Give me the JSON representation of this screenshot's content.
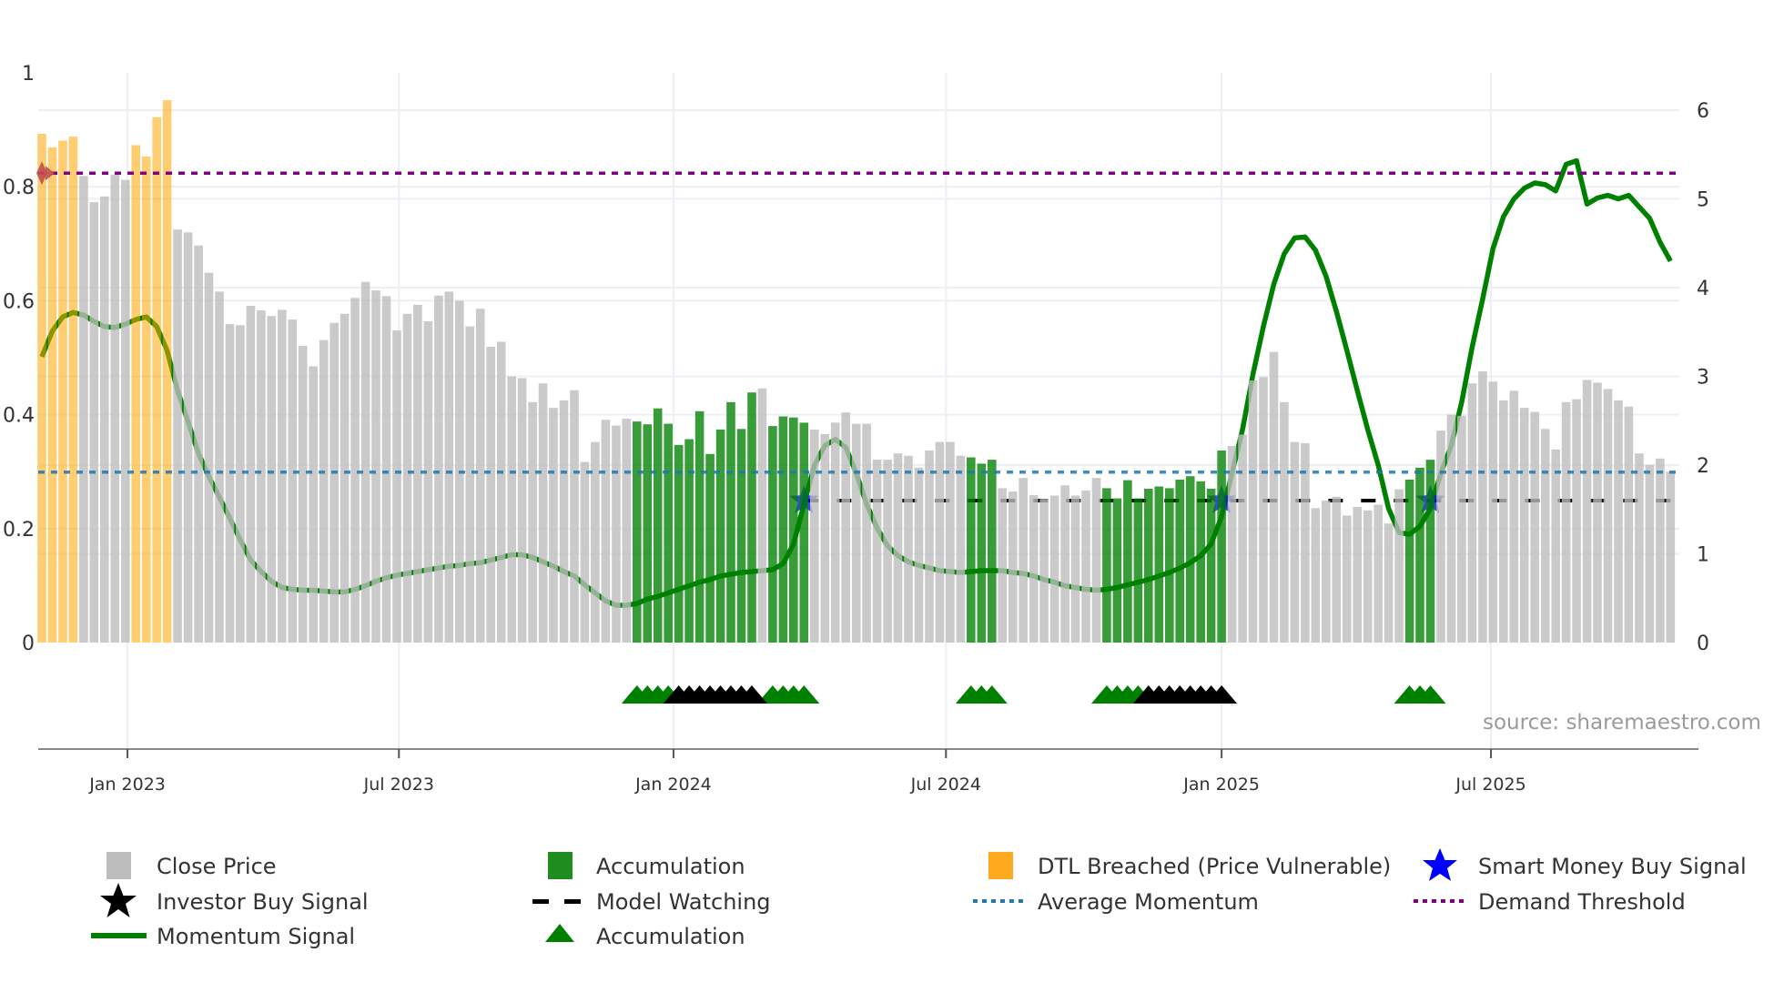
{
  "chart_data": {
    "type": "bar",
    "title": "",
    "xlabel": "",
    "ylabel_left": "",
    "ylabel_right": "",
    "ylim_left": [
      0,
      1
    ],
    "ylim_right": [
      0,
      6
    ],
    "yticks_left": [
      "0",
      "0.2",
      "0.4",
      "0.6",
      "0.8",
      "1"
    ],
    "yticks_right": [
      "0",
      "1",
      "2",
      "3",
      "4",
      "5",
      "6"
    ],
    "grid": true,
    "x_unit": "week index (1 = first weekly bar)",
    "x_ticks": [
      {
        "label": "Jan 2023",
        "week": 9.2
      },
      {
        "label": "Jul 2023",
        "week": 35.2
      },
      {
        "label": "Jan 2024",
        "week": 61.5
      },
      {
        "label": "Jul 2024",
        "week": 87.6
      },
      {
        "label": "Jan 2025",
        "week": 114.0
      },
      {
        "label": "Jul 2025",
        "week": 139.8
      }
    ],
    "close_price": [
      0.893,
      0.869,
      0.881,
      0.888,
      0.819,
      0.773,
      0.783,
      0.821,
      0.812,
      0.873,
      0.853,
      0.922,
      0.952,
      0.725,
      0.72,
      0.697,
      0.649,
      0.616,
      0.559,
      0.557,
      0.591,
      0.583,
      0.573,
      0.584,
      0.567,
      0.521,
      0.485,
      0.531,
      0.561,
      0.577,
      0.605,
      0.633,
      0.618,
      0.608,
      0.548,
      0.577,
      0.593,
      0.564,
      0.609,
      0.616,
      0.6,
      0.555,
      0.586,
      0.519,
      0.528,
      0.467,
      0.464,
      0.422,
      0.455,
      0.412,
      0.425,
      0.443,
      0.317,
      0.352,
      0.391,
      0.381,
      0.393,
      0.388,
      0.383,
      0.411,
      0.384,
      0.347,
      0.357,
      0.406,
      0.331,
      0.374,
      0.422,
      0.375,
      0.439,
      0.446,
      0.38,
      0.397,
      0.395,
      0.386,
      0.374,
      0.366,
      0.386,
      0.404,
      0.384,
      0.384,
      0.321,
      0.321,
      0.332,
      0.328,
      0.307,
      0.337,
      0.352,
      0.352,
      0.328,
      0.325,
      0.314,
      0.321,
      0.271,
      0.265,
      0.289,
      0.259,
      0.252,
      0.258,
      0.276,
      0.258,
      0.267,
      0.289,
      0.271,
      0.253,
      0.285,
      0.253,
      0.27,
      0.274,
      0.271,
      0.286,
      0.292,
      0.283,
      0.27,
      0.337,
      0.345,
      0.365,
      0.46,
      0.466,
      0.51,
      0.422,
      0.352,
      0.35,
      0.236,
      0.249,
      0.256,
      0.223,
      0.238,
      0.232,
      0.242,
      0.209,
      0.269,
      0.286,
      0.307,
      0.321,
      0.372,
      0.4,
      0.398,
      0.455,
      0.476,
      0.458,
      0.425,
      0.442,
      0.412,
      0.405,
      0.375,
      0.339,
      0.422,
      0.427,
      0.461,
      0.456,
      0.445,
      0.425,
      0.414,
      0.332,
      0.312,
      0.323,
      0.3
    ],
    "momentum_signal": [
      3.22,
      3.51,
      3.67,
      3.72,
      3.69,
      3.62,
      3.56,
      3.55,
      3.59,
      3.64,
      3.67,
      3.56,
      3.29,
      2.84,
      2.49,
      2.13,
      1.87,
      1.64,
      1.4,
      1.16,
      0.93,
      0.8,
      0.69,
      0.62,
      0.6,
      0.59,
      0.59,
      0.58,
      0.57,
      0.57,
      0.6,
      0.64,
      0.69,
      0.73,
      0.76,
      0.78,
      0.8,
      0.82,
      0.84,
      0.86,
      0.87,
      0.89,
      0.9,
      0.93,
      0.96,
      0.99,
      0.99,
      0.96,
      0.91,
      0.86,
      0.8,
      0.75,
      0.65,
      0.56,
      0.47,
      0.42,
      0.42,
      0.44,
      0.49,
      0.52,
      0.56,
      0.6,
      0.64,
      0.68,
      0.71,
      0.75,
      0.77,
      0.79,
      0.8,
      0.81,
      0.82,
      0.89,
      1.11,
      1.56,
      2.0,
      2.22,
      2.29,
      2.2,
      1.91,
      1.56,
      1.29,
      1.09,
      0.98,
      0.91,
      0.87,
      0.84,
      0.81,
      0.8,
      0.79,
      0.8,
      0.81,
      0.81,
      0.81,
      0.79,
      0.78,
      0.75,
      0.71,
      0.68,
      0.64,
      0.62,
      0.6,
      0.59,
      0.6,
      0.62,
      0.65,
      0.68,
      0.71,
      0.75,
      0.79,
      0.84,
      0.9,
      0.98,
      1.11,
      1.42,
      1.91,
      2.4,
      3.02,
      3.56,
      4.04,
      4.38,
      4.56,
      4.57,
      4.42,
      4.13,
      3.73,
      3.29,
      2.84,
      2.4,
      2.0,
      1.51,
      1.24,
      1.22,
      1.31,
      1.51,
      1.91,
      2.22,
      2.71,
      3.33,
      3.87,
      4.44,
      4.8,
      5.0,
      5.12,
      5.18,
      5.16,
      5.09,
      5.39,
      5.43,
      4.94,
      5.01,
      5.04,
      5.0,
      5.04,
      4.91,
      4.78,
      4.51,
      4.3
    ],
    "dtl_breached_weeks": [
      [
        1,
        4
      ],
      [
        10,
        13
      ]
    ],
    "accumulation_bar_weeks": [
      [
        58,
        69
      ],
      [
        71,
        74
      ],
      [
        90,
        92
      ],
      [
        103,
        114
      ],
      [
        132,
        134
      ]
    ],
    "accumulation_triangle_weeks": [
      [
        58,
        61
      ],
      [
        71,
        74
      ],
      [
        90,
        92
      ],
      [
        103,
        106
      ],
      [
        132,
        134
      ]
    ],
    "black_triangle_weeks": [
      [
        62,
        69
      ],
      [
        107,
        114
      ]
    ],
    "smart_money_buy_weeks": [
      74,
      114,
      134
    ],
    "smart_money_buy_level": 1.6,
    "model_watching": {
      "from_week": 74,
      "level": 1.6
    },
    "average_momentum": 1.92,
    "demand_threshold": 5.29,
    "dtl_marker_week": 1,
    "colors": {
      "close": "#bdbdbd",
      "accumulation": "#008000",
      "dtl": "#ffa500",
      "momentum": "#008000",
      "average_momentum": "#1f77b4",
      "demand_threshold": "#800080",
      "model_watching": "#000000",
      "smart_money": "#0000ff",
      "investor_buy": "#000000",
      "dtl_marker": "#c0504d",
      "grid": "#eceff4"
    },
    "legend": {
      "placement": "bottom",
      "items": [
        {
          "label": "Close Price",
          "icon": "gray-square-icon"
        },
        {
          "label": "Accumulation",
          "icon": "green-square-icon"
        },
        {
          "label": "DTL Breached (Price Vulnerable)",
          "icon": "orange-square-icon"
        },
        {
          "label": "Smart Money Buy Signal",
          "icon": "blue-star-icon"
        },
        {
          "label": "Investor Buy Signal",
          "icon": "black-star-icon"
        },
        {
          "label": "Model Watching",
          "icon": "black-dash-icon"
        },
        {
          "label": "Average Momentum",
          "icon": "blue-dotted-line-icon"
        },
        {
          "label": "Demand Threshold",
          "icon": "purple-dotted-line-icon"
        },
        {
          "label": "Momentum Signal",
          "icon": "green-line-icon"
        },
        {
          "label": "Accumulation",
          "icon": "green-triangle-icon"
        }
      ]
    },
    "source": "source: sharemaestro.com"
  }
}
